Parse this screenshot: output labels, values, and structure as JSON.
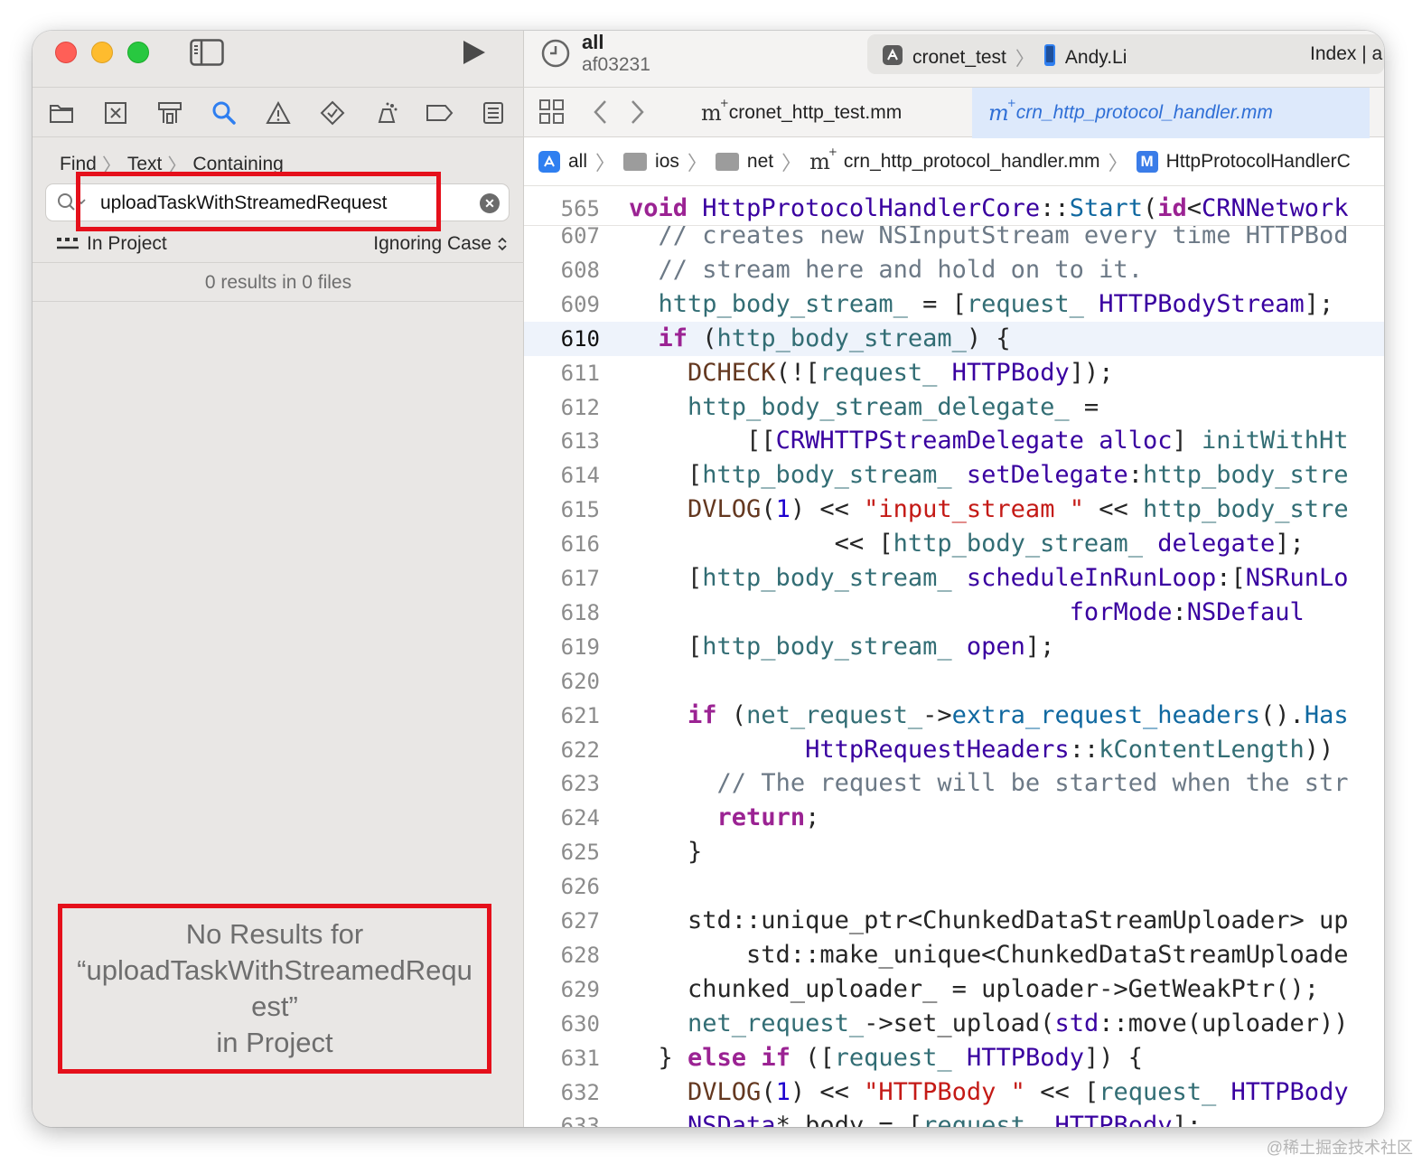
{
  "window": {
    "scheme": {
      "name": "all",
      "commit": "af03231"
    },
    "target": {
      "project": "cronet_test",
      "device": "Andy.Li",
      "status": "Index | a"
    }
  },
  "navigator": {
    "find_path": [
      "Find",
      "Text",
      "Containing"
    ],
    "search": {
      "query": "uploadTaskWithStreamedRequest"
    },
    "scope": "In Project",
    "matching": "Ignoring Case",
    "results_summary": "0 results in 0 files",
    "no_results": {
      "line1": "No Results for",
      "line2": "“uploadTaskWithStreamedRequ",
      "line3": "est”",
      "line4": "in Project"
    }
  },
  "tabs": [
    {
      "label": "cronet_http_test.mm",
      "active": false
    },
    {
      "label": "crn_http_protocol_handler.mm",
      "active": true
    }
  ],
  "jumpbar": {
    "items": [
      "all",
      "ios",
      "net",
      "crn_http_protocol_handler.mm",
      "HttpProtocolHandlerC"
    ]
  },
  "editor": {
    "current_line": 610,
    "lines": [
      {
        "n": "565",
        "html": "<span class='k'>void</span> <span class='t'>HttpProtocolHandlerCore</span>::<span class='p'>Start</span>(<span class='k'>id</span>&lt;<span class='t'>CRNNetwork</span>"
      },
      {
        "n": "607",
        "html": "  <span class='c'>// creates new NSInputStream every time HTTPBod</span>"
      },
      {
        "n": "608",
        "html": "  <span class='c'>// stream here and hold on to it.</span>"
      },
      {
        "n": "609",
        "html": "  <span class='v'>http_body_stream_</span> = [<span class='v'>request_</span> <span class='t'>HTTPBodyStream</span>];"
      },
      {
        "n": "610",
        "html": "  <span class='k'>if</span> (<span class='v'>http_body_stream_</span>) {"
      },
      {
        "n": "611",
        "html": "    <span class='m'>DCHECK</span>(![<span class='v'>request_</span> <span class='t'>HTTPBody</span>]);"
      },
      {
        "n": "612",
        "html": "    <span class='v'>http_body_stream_delegate_</span> ="
      },
      {
        "n": "613",
        "html": "        [[<span class='t'>CRWHTTPStreamDelegate</span> <span class='t'>alloc</span>] <span class='v'>initWithHt</span>"
      },
      {
        "n": "614",
        "html": "    [<span class='v'>http_body_stream_</span> <span class='t'>setDelegate</span>:<span class='v'>http_body_stre</span>"
      },
      {
        "n": "615",
        "html": "    <span class='m'>DVLOG</span>(<span class='n'>1</span>) &lt;&lt; <span class='s'>\"input_stream \"</span> &lt;&lt; <span class='v'>http_body_stre</span>"
      },
      {
        "n": "616",
        "html": "              &lt;&lt; [<span class='v'>http_body_stream_</span> <span class='t'>delegate</span>];"
      },
      {
        "n": "617",
        "html": "    [<span class='v'>http_body_stream_</span> <span class='t'>scheduleInRunLoop</span>:[<span class='t'>NSRunLo</span>"
      },
      {
        "n": "618",
        "html": "                              <span class='t'>forMode</span>:<span class='t'>NSDefaul</span>"
      },
      {
        "n": "619",
        "html": "    [<span class='v'>http_body_stream_</span> <span class='t'>open</span>];"
      },
      {
        "n": "620",
        "html": ""
      },
      {
        "n": "621",
        "html": "    <span class='k'>if</span> (<span class='v'>net_request_</span>-&gt;<span class='p'>extra_request_headers</span>().<span class='p'>Has</span>"
      },
      {
        "n": "622",
        "html": "            <span class='t'>HttpRequestHeaders</span>::<span class='v'>kContentLength</span>))"
      },
      {
        "n": "623",
        "html": "      <span class='c'>// The request will be started when the str</span>"
      },
      {
        "n": "624",
        "html": "      <span class='k'>return</span>;"
      },
      {
        "n": "625",
        "html": "    }"
      },
      {
        "n": "626",
        "html": ""
      },
      {
        "n": "627",
        "html": "    std::unique_ptr&lt;ChunkedDataStreamUploader&gt; up"
      },
      {
        "n": "628",
        "html": "        std::make_unique&lt;ChunkedDataStreamUploade"
      },
      {
        "n": "629",
        "html": "    chunked_uploader_ = uploader-&gt;GetWeakPtr();"
      },
      {
        "n": "630",
        "html": "    <span class='v'>net_request_</span>-&gt;set_upload(<span class='t'>std</span>::move(uploader))"
      },
      {
        "n": "631",
        "html": "  } <span class='k'>else</span> <span class='k'>if</span> ([<span class='v'>request_</span> <span class='t'>HTTPBody</span>]) {"
      },
      {
        "n": "632",
        "html": "    <span class='m'>DVLOG</span>(<span class='n'>1</span>) &lt;&lt; <span class='s'>\"HTTPBody \"</span> &lt;&lt; [<span class='v'>request_</span> <span class='t'>HTTPBody</span>"
      },
      {
        "n": "633",
        "html": "    <span class='t'>NSData</span>* body = [<span class='v'>request_</span> <span class='t'>HTTPBody</span>];"
      }
    ]
  },
  "watermark": "@稀土掘金技术社区",
  "colors": {
    "annotation_red": "#e5101b",
    "accent_blue": "#2f6fd6",
    "keyword": "#9b2393",
    "comment": "#6c7986",
    "string": "#c41a16"
  }
}
